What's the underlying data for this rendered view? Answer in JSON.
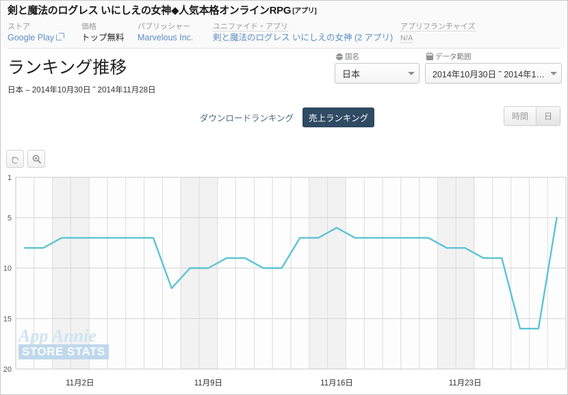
{
  "header": {
    "app_title": "剣と魔法のログレス いにしえの女神◆人気本格オンラインRPG",
    "app_title_suffix": "[アプリ]",
    "meta": [
      {
        "label": "ストア",
        "value": "Google Play",
        "is_link": true,
        "has_ext_icon": true
      },
      {
        "label": "価格",
        "value": "トップ無料",
        "is_link": false
      },
      {
        "label": "パブリッシャー",
        "value": "Marvelous Inc.",
        "is_link": true
      },
      {
        "label": "ユニファイド・アプリ",
        "value": "剣と魔法のログレス いにしえの女神 (2 アプリ)",
        "is_link": true
      },
      {
        "label": "アプリフランチャイズ",
        "value": "N/A",
        "is_link": false
      }
    ]
  },
  "title_block": {
    "page_title": "ランキング推移",
    "subtitle": "日本 – 2014年10月30日 ˜ 2014年11月28日"
  },
  "selectors": {
    "country": {
      "label": "国名",
      "value": "日本",
      "icon": "globe-icon"
    },
    "daterange": {
      "label": "データ範囲",
      "value": "2014年10月30日 ˜ 2014年1…",
      "icon": "calendar-icon"
    }
  },
  "tabs": [
    {
      "label": "ダウンロードランキング",
      "active": false
    },
    {
      "label": "売上ランキング",
      "active": true
    }
  ],
  "granularity": [
    {
      "label": "時間",
      "selected": false
    },
    {
      "label": "日",
      "selected": true
    }
  ],
  "chart_toolbar": [
    {
      "name": "reset-zoom-button",
      "icon": "undo-icon"
    },
    {
      "name": "zoom-in-button",
      "icon": "magnifier-plus-icon"
    }
  ],
  "watermark": {
    "line1": "App Annie",
    "line2": "STORE STATS"
  },
  "colors": {
    "line": "#5bc4d4",
    "active_tab_bg": "#2f4a63",
    "link": "#5b8ec4",
    "grid": "#d8d8d8",
    "weekend_band": "#f2f2f2"
  },
  "chart_data": {
    "type": "line",
    "title": "ランキング推移",
    "xlabel": "",
    "ylabel": "",
    "ylim": [
      1,
      20
    ],
    "y_inverted": true,
    "yticks": [
      1,
      5,
      10,
      15,
      20
    ],
    "ytick_labels": [
      "1",
      "5",
      "10",
      "15",
      "20"
    ],
    "xticks": [
      3,
      10,
      17,
      24
    ],
    "xtick_labels": [
      "11月2日",
      "11月9日",
      "11月16日",
      "11月23日"
    ],
    "grid": true,
    "legend": null,
    "series": [
      {
        "name": "売上ランキング",
        "color": "#5bc4d4",
        "x": [
          "2014-10-30",
          "2014-10-31",
          "2014-11-01",
          "2014-11-02",
          "2014-11-03",
          "2014-11-04",
          "2014-11-05",
          "2014-11-06",
          "2014-11-07",
          "2014-11-08",
          "2014-11-09",
          "2014-11-10",
          "2014-11-11",
          "2014-11-12",
          "2014-11-13",
          "2014-11-14",
          "2014-11-15",
          "2014-11-16",
          "2014-11-17",
          "2014-11-18",
          "2014-11-19",
          "2014-11-20",
          "2014-11-21",
          "2014-11-22",
          "2014-11-23",
          "2014-11-24",
          "2014-11-25",
          "2014-11-26",
          "2014-11-27",
          "2014-11-28"
        ],
        "values": [
          8,
          8,
          7,
          7,
          7,
          7,
          7,
          7,
          12,
          10,
          10,
          9,
          9,
          10,
          10,
          7,
          7,
          6,
          7,
          7,
          7,
          7,
          7,
          8,
          8,
          9,
          9,
          16,
          16,
          5
        ]
      }
    ],
    "weekend_bands": [
      [
        2,
        4
      ],
      [
        9,
        11
      ],
      [
        16,
        18
      ],
      [
        23,
        25
      ]
    ]
  }
}
